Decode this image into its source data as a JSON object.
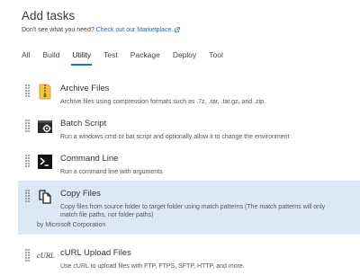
{
  "header": {
    "title": "Add tasks",
    "subtitle_prefix": "Don't see what you need?",
    "marketplace_link": "Check out our Marketplace."
  },
  "tabs": [
    {
      "label": "All"
    },
    {
      "label": "Build"
    },
    {
      "label": "Utility",
      "active": true
    },
    {
      "label": "Test"
    },
    {
      "label": "Package"
    },
    {
      "label": "Deploy"
    },
    {
      "label": "Tool"
    }
  ],
  "tasks": [
    {
      "name": "Archive Files",
      "description": "Archive files using compression formats such as .7z, .rar, .tar.gz, and .zip.",
      "icon": "archive-icon"
    },
    {
      "name": "Batch Script",
      "description": "Run a windows cmd or bat script and optionally allow it to change the environment",
      "icon": "batch-script-icon"
    },
    {
      "name": "Command Line",
      "description": "Run a command line with arguments",
      "icon": "terminal-icon"
    },
    {
      "name": "Copy Files",
      "description": "Copy files from source folder to target folder using match patterns (The match patterns will only match file paths, not folder paths)",
      "icon": "copy-files-icon",
      "selected": true,
      "publisher": "by Microsoft Corporation"
    },
    {
      "name": "cURL Upload Files",
      "description": "Use cURL to upload files with FTP, FTPS, SFTP, HTTP, and more.",
      "icon": "curl-icon",
      "icon_text": "cURL"
    }
  ],
  "colors": {
    "accent": "#1a73c9",
    "link": "#1a6fc2",
    "selected_bg": "#dbe9f7"
  }
}
